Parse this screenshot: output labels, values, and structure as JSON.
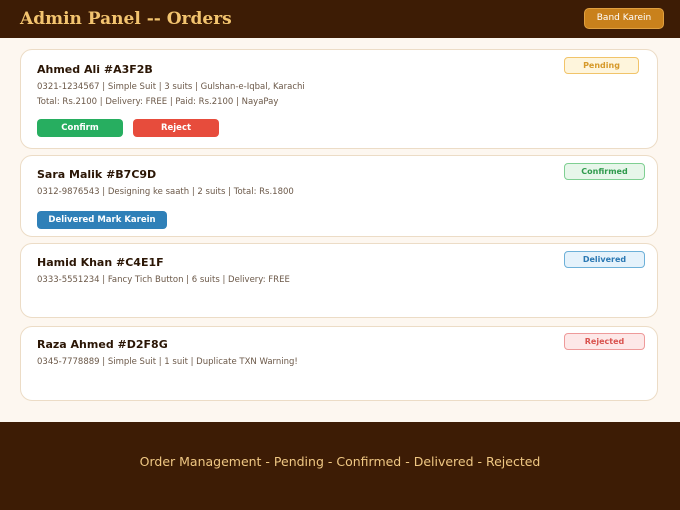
{
  "header": {
    "title": "Admin Panel -- Orders",
    "close_label": "Band Karein"
  },
  "orders": [
    {
      "title": "Ahmed Ali #A3F2B",
      "line1": "0321-1234567 | Simple Suit | 3 suits | Gulshan-e-Iqbal, Karachi",
      "line2": "Total: Rs.2100 | Delivery: FREE | Paid: Rs.2100 | NayaPay",
      "status": "Pending",
      "actions": {
        "confirm": "Confirm",
        "reject": "Reject"
      }
    },
    {
      "title": "Sara Malik #B7C9D",
      "line1": "0312-9876543 | Designing ke saath | 2 suits | Total: Rs.1800",
      "status": "Confirmed",
      "actions": {
        "delivered": "Delivered Mark Karein"
      }
    },
    {
      "title": "Hamid Khan #C4E1F",
      "line1": "0333-5551234 | Fancy Tich Button | 6 suits | Delivery: FREE",
      "status": "Delivered"
    },
    {
      "title": "Raza Ahmed #D2F8G",
      "line1": "0345-7778889 | Simple Suit | 1 suit | Duplicate TXN Warning!",
      "status": "Rejected"
    }
  ],
  "footer": {
    "text": "Order Management - Pending - Confirmed - Delivered - Rejected"
  },
  "colors": {
    "header_bg": "#3d1c05",
    "title": "#f3c46f",
    "close_button": "#c9811c",
    "confirm": "#27ae60",
    "reject": "#e74c3c",
    "delivered_action": "#2f80b8",
    "pending": "#d69a2b",
    "confirmed": "#2f9a4c",
    "delivered": "#2a78b3",
    "rejected": "#d9534f"
  }
}
